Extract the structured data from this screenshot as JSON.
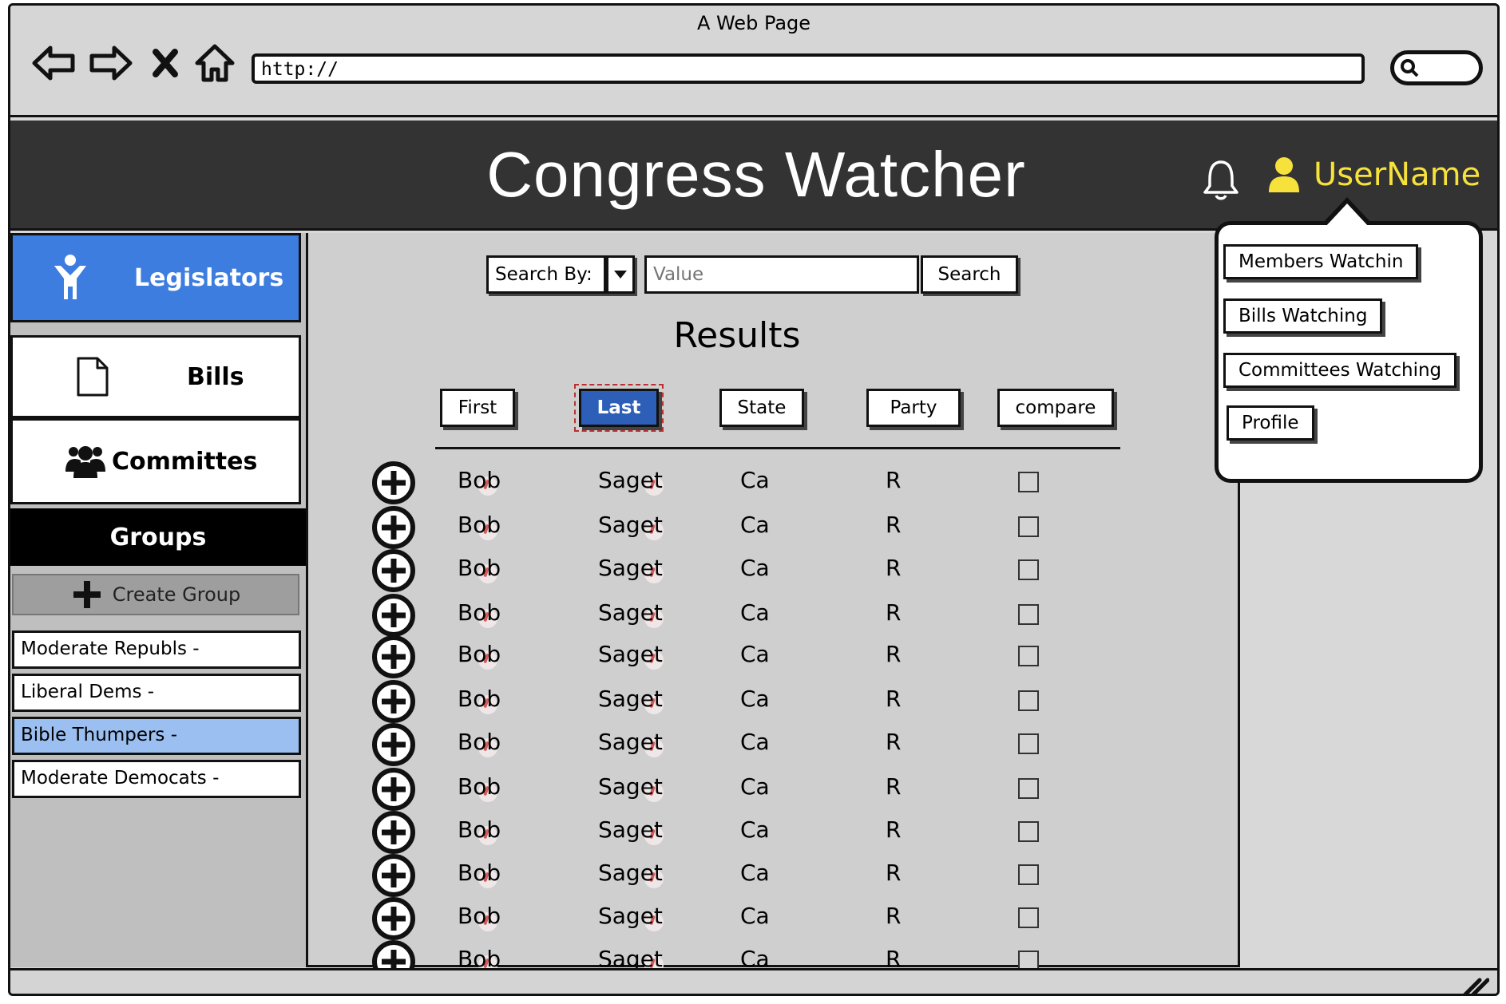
{
  "window": {
    "title": "A Web Page"
  },
  "address_bar": {
    "url": "http://"
  },
  "app": {
    "title": "Congress Watcher",
    "username": "UserName",
    "accent_color": "#f7e23c"
  },
  "sidebar": {
    "nav": [
      {
        "label": "Legislators",
        "icon": "person-icon",
        "active": true
      },
      {
        "label": "Bills",
        "icon": "document-icon",
        "active": false
      },
      {
        "label": "Committes",
        "icon": "group-icon",
        "active": false
      }
    ],
    "groups_header": "Groups",
    "create_group_label": "Create Group",
    "groups": [
      {
        "label": "Moderate Republs  -",
        "selected": false
      },
      {
        "label": "Liberal Dems -",
        "selected": false
      },
      {
        "label": "Bible Thumpers -",
        "selected": true
      },
      {
        "label": "Moderate Democats -",
        "selected": false
      }
    ]
  },
  "search": {
    "by_label": "Search By:",
    "value_placeholder": "Value",
    "button_label": "Search"
  },
  "results": {
    "heading": "Results",
    "columns": [
      "First",
      "Last",
      "State",
      "Party",
      "compare"
    ],
    "active_column": "Last",
    "rows": [
      {
        "first": "Bob",
        "last": "Saget",
        "state": "Ca",
        "party": "R"
      },
      {
        "first": "Bob",
        "last": "Saget",
        "state": "Ca",
        "party": "R"
      },
      {
        "first": "Bob",
        "last": "Saget",
        "state": "Ca",
        "party": "R"
      },
      {
        "first": "Bob",
        "last": "Saget",
        "state": "Ca",
        "party": "R"
      },
      {
        "first": "Bob",
        "last": "Saget",
        "state": "Ca",
        "party": "R"
      },
      {
        "first": "Bob",
        "last": "Saget",
        "state": "Ca",
        "party": "R"
      },
      {
        "first": "Bob",
        "last": "Saget",
        "state": "Ca",
        "party": "R"
      },
      {
        "first": "Bob",
        "last": "Saget",
        "state": "Ca",
        "party": "R"
      },
      {
        "first": "Bob",
        "last": "Saget",
        "state": "Ca",
        "party": "R"
      },
      {
        "first": "Bob",
        "last": "Saget",
        "state": "Ca",
        "party": "R"
      },
      {
        "first": "Bob",
        "last": "Saget",
        "state": "Ca",
        "party": "R"
      },
      {
        "first": "Bob",
        "last": "Saget",
        "state": "Ca",
        "party": "R"
      }
    ]
  },
  "user_menu": {
    "items": [
      "Members Watchin",
      "Bills Watching",
      "Committees Watching",
      "Profile"
    ]
  }
}
